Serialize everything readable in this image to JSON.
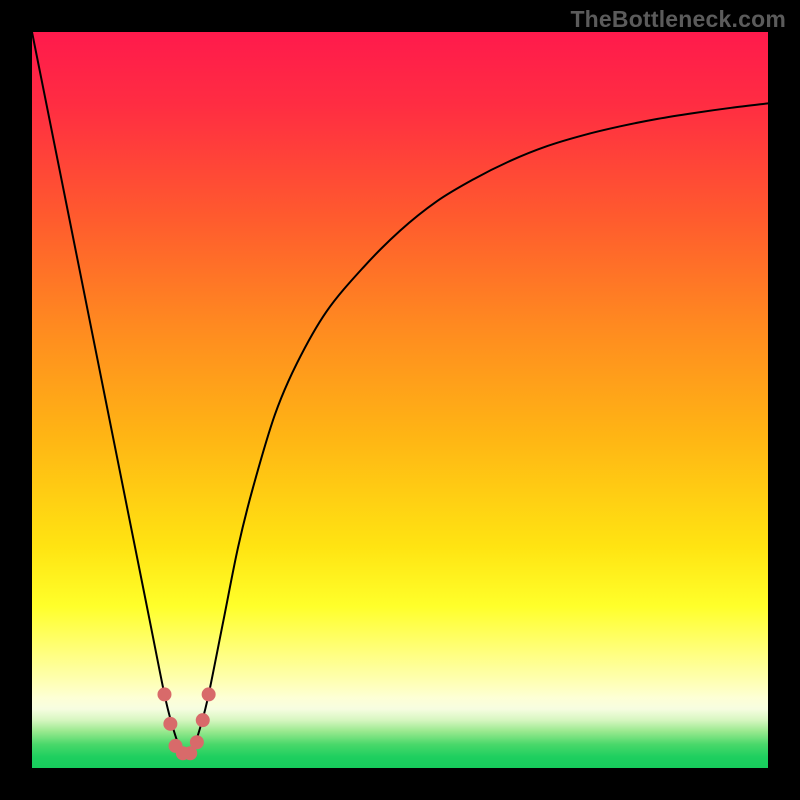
{
  "watermark": "TheBottleneck.com",
  "chart_data": {
    "type": "line",
    "title": "",
    "xlabel": "",
    "ylabel": "",
    "xlim": [
      0,
      100
    ],
    "ylim": [
      0,
      100
    ],
    "gradient_stops": [
      {
        "offset": 0.0,
        "color": "#ff1a4c"
      },
      {
        "offset": 0.1,
        "color": "#ff2d42"
      },
      {
        "offset": 0.25,
        "color": "#ff5a2e"
      },
      {
        "offset": 0.4,
        "color": "#ff8a20"
      },
      {
        "offset": 0.55,
        "color": "#ffb514"
      },
      {
        "offset": 0.7,
        "color": "#ffe412"
      },
      {
        "offset": 0.78,
        "color": "#ffff2a"
      },
      {
        "offset": 0.84,
        "color": "#ffff7a"
      },
      {
        "offset": 0.88,
        "color": "#feffb0"
      },
      {
        "offset": 0.905,
        "color": "#fdffd6"
      },
      {
        "offset": 0.92,
        "color": "#f6fde0"
      },
      {
        "offset": 0.935,
        "color": "#d6f6c0"
      },
      {
        "offset": 0.95,
        "color": "#9ae98f"
      },
      {
        "offset": 0.968,
        "color": "#49d86a"
      },
      {
        "offset": 0.985,
        "color": "#1ecf5f"
      },
      {
        "offset": 1.0,
        "color": "#17cc5c"
      }
    ],
    "series": [
      {
        "name": "bottleneck-curve",
        "color": "#000000",
        "width": 2,
        "x": [
          0,
          2,
          4,
          6,
          8,
          10,
          12,
          14,
          16,
          18,
          19,
          20,
          21,
          22,
          23,
          24,
          26,
          28,
          30,
          33,
          36,
          40,
          45,
          50,
          55,
          60,
          65,
          70,
          75,
          80,
          85,
          90,
          95,
          100
        ],
        "values": [
          100,
          90,
          80,
          70,
          60,
          50,
          40,
          30,
          20,
          10,
          6,
          3,
          2,
          3,
          6,
          10,
          20,
          30,
          38,
          48,
          55,
          62,
          68,
          73,
          77,
          80,
          82.5,
          84.5,
          86,
          87.2,
          88.2,
          89,
          89.7,
          90.3
        ]
      }
    ],
    "markers": {
      "name": "minimum-cluster",
      "color": "#d86a6a",
      "radius": 7,
      "points": [
        {
          "x": 18.0,
          "y": 10.0
        },
        {
          "x": 18.8,
          "y": 6.0
        },
        {
          "x": 19.5,
          "y": 3.0
        },
        {
          "x": 20.5,
          "y": 2.0
        },
        {
          "x": 21.5,
          "y": 2.0
        },
        {
          "x": 22.4,
          "y": 3.5
        },
        {
          "x": 23.2,
          "y": 6.5
        },
        {
          "x": 24.0,
          "y": 10.0
        }
      ]
    }
  }
}
